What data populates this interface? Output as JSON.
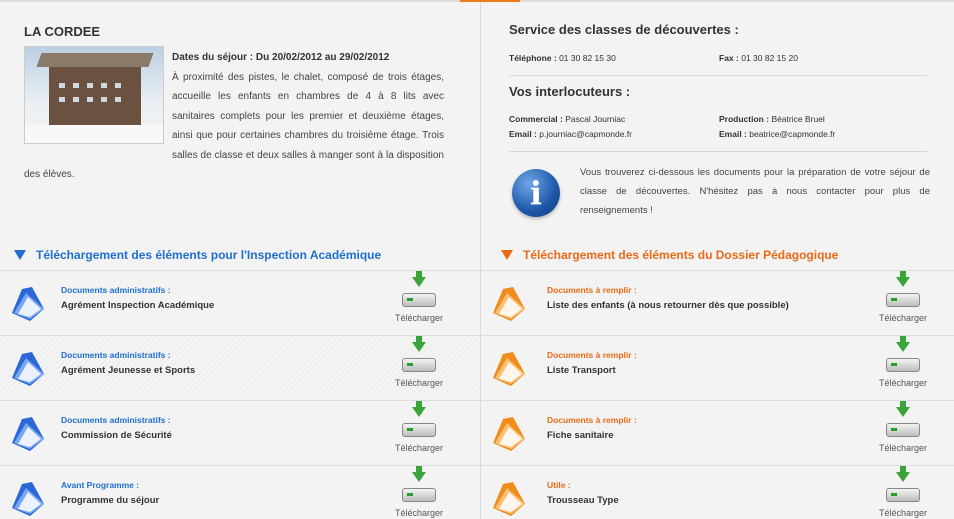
{
  "colors": {
    "blue": "#1f6fd1",
    "orange": "#ea6a16"
  },
  "left": {
    "title": "LA CORDEE",
    "dates": "Dates du séjour : Du 20/02/2012 au 29/02/2012",
    "description": "À proximité des pistes, le chalet, composé de trois étages, accueille les enfants en chambres de 4 à 8 lits avec sanitaires complets pour les premier et deuxième étages, ainsi que pour certaines chambres du troisième étage. Trois salles de classe et deux salles à manger sont à la disposition des élèves.",
    "section_title": "Téléchargement des éléments pour l'Inspection Académique",
    "download_label": "Télécharger",
    "rows": [
      {
        "category": "Documents administratifs :",
        "name": "Agrément Inspection Académique"
      },
      {
        "category": "Documents administratifs :",
        "name": "Agrément Jeunesse et Sports"
      },
      {
        "category": "Documents administratifs :",
        "name": "Commission de Sécurité"
      },
      {
        "category": "Avant Programme :",
        "name": "Programme du séjour"
      }
    ]
  },
  "right": {
    "service_title": "Service des classes de découvertes :",
    "phone_label": "Téléphone :",
    "phone_value": "01 30 82 15 30",
    "fax_label": "Fax :",
    "fax_value": "01 30 82 15 20",
    "contacts_title": "Vos interlocuteurs :",
    "commercial_label": "Commercial :",
    "commercial_value": "Pascal Journiac",
    "production_label": "Production :",
    "production_value": "Béatrice Bruel",
    "email_label": "Email :",
    "email1": "p.journiac@capmonde.fr",
    "email2": "beatrice@capmonde.fr",
    "info_text": "Vous trouverez ci-dessous les documents pour la préparation de votre séjour de classe de découvertes. N'hésitez pas à nous contacter pour plus de renseignements !",
    "section_title": "Téléchargement des éléments du Dossier Pédagogique",
    "download_label": "Télécharger",
    "rows": [
      {
        "category": "Documents à remplir :",
        "name": "Liste des enfants (à nous retourner dès que possible)"
      },
      {
        "category": "Documents à remplir :",
        "name": "Liste Transport"
      },
      {
        "category": "Documents à remplir :",
        "name": "Fiche sanitaire"
      },
      {
        "category": "Utile :",
        "name": "Trousseau Type"
      }
    ]
  }
}
